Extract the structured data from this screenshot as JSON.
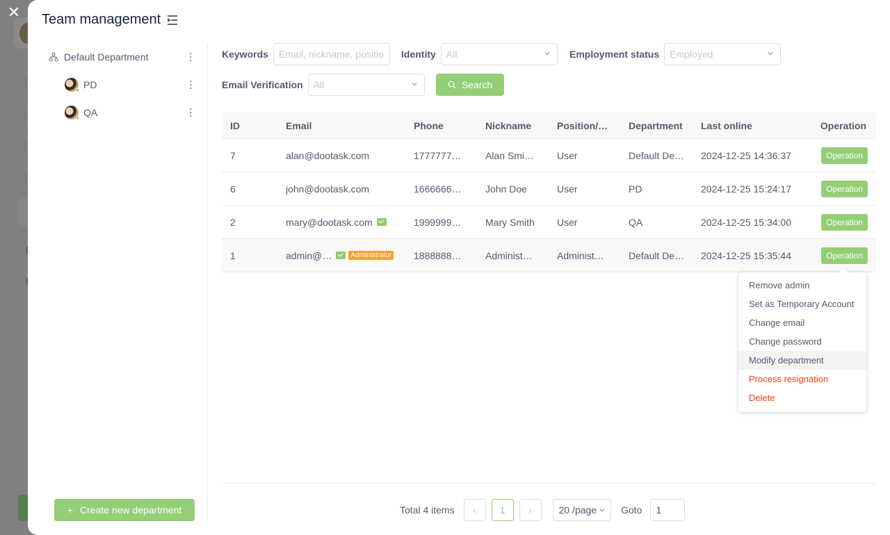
{
  "title": "Team management",
  "sidebar": {
    "root": {
      "label": "Default Department"
    },
    "children": [
      {
        "label": "PD"
      },
      {
        "label": "QA"
      }
    ],
    "create_label": "Create new department"
  },
  "filters": {
    "keywords": {
      "label": "Keywords",
      "placeholder": "Email, nickname, positio"
    },
    "identity": {
      "label": "Identity",
      "value": "All"
    },
    "employment": {
      "label": "Employment status",
      "value": "Employed"
    },
    "email_verification": {
      "label": "Email Verification",
      "value": "All"
    },
    "search_label": "Search"
  },
  "table": {
    "headers": [
      "ID",
      "Email",
      "Phone",
      "Nickname",
      "Position/…",
      "Department",
      "Last online",
      "Operation"
    ],
    "rows": [
      {
        "id": "7",
        "email": "alan@dootask.com",
        "verified": false,
        "admin": false,
        "phone": "1777777…",
        "nickname": "Alan Smi…",
        "position": "User",
        "department": "Default De…",
        "last_online": "2024-12-25 14:36:37",
        "op": "Operation"
      },
      {
        "id": "6",
        "email": "john@dootask.com",
        "verified": false,
        "admin": false,
        "phone": "1666666…",
        "nickname": "John Doe",
        "position": "User",
        "department": "PD",
        "last_online": "2024-12-25 15:24:17",
        "op": "Operation"
      },
      {
        "id": "2",
        "email": "mary@dootask.com",
        "verified": true,
        "admin": false,
        "phone": "1999999…",
        "nickname": "Mary Smith",
        "position": "User",
        "department": "QA",
        "last_online": "2024-12-25 15:34:00",
        "op": "Operation"
      },
      {
        "id": "1",
        "email": "admin@…",
        "verified": true,
        "admin": true,
        "phone": "1888888…",
        "nickname": "Administ…",
        "position": "Administ…",
        "department": "Default De…",
        "last_online": "2024-12-25 15:35:44",
        "op": "Operation"
      }
    ],
    "admin_badge": "Administrator"
  },
  "dropdown": {
    "items": [
      {
        "label": "Remove admin"
      },
      {
        "label": "Set as Temporary Account"
      },
      {
        "label": "Change email"
      },
      {
        "label": "Change password"
      },
      {
        "label": "Modify department"
      },
      {
        "label": "Process resignation"
      },
      {
        "label": "Delete"
      }
    ]
  },
  "pagination": {
    "total": "Total 4 items",
    "current": "1",
    "page_size": "20 /page",
    "goto_label": "Goto",
    "goto_value": "1"
  },
  "colors": {
    "accent": "#94ce76",
    "danger": "#ed4014",
    "badge": "#f3a12e"
  }
}
